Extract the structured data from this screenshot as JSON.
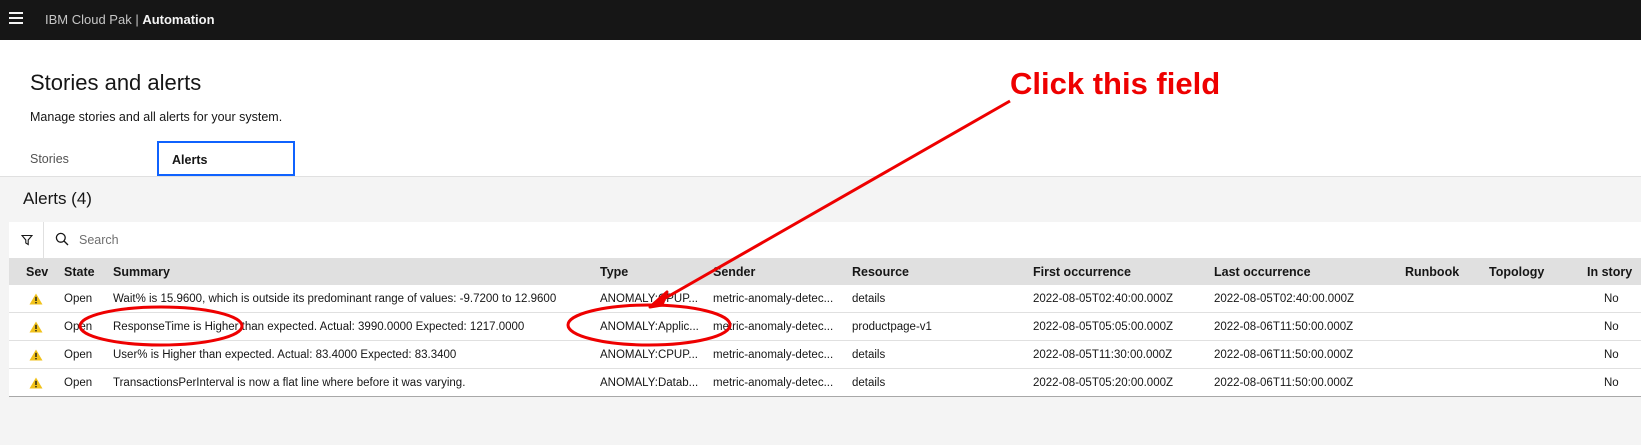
{
  "header": {
    "brand_prefix": "IBM Cloud Pak",
    "separator": " | ",
    "product": "Automation",
    "menu_icon": "hamburger-menu-icon"
  },
  "page": {
    "title": "Stories and alerts",
    "description": "Manage stories and all alerts for your system."
  },
  "tabs": [
    {
      "label": "Stories",
      "selected": false
    },
    {
      "label": "Alerts",
      "selected": true
    }
  ],
  "alerts": {
    "heading": "Alerts (4)",
    "filter_icon": "filter-icon",
    "search_icon": "search-icon",
    "search_placeholder": "Search",
    "columns": [
      "Sev",
      "State",
      "Summary",
      "Type",
      "Sender",
      "Resource",
      "First occurrence",
      "Last occurrence",
      "Runbook",
      "Topology",
      "In story"
    ],
    "rows": [
      {
        "sev": "warning",
        "state": "Open",
        "summary": "Wait% is 15.9600, which is outside its predominant range of values: -9.7200 to 12.9600",
        "type": "ANOMALY:CPUP...",
        "sender": "metric-anomaly-detec...",
        "resource": "details",
        "first": "2022-08-05T02:40:00.000Z",
        "last": "2022-08-05T02:40:00.000Z",
        "runbook": "",
        "topology": "",
        "in_story": "No"
      },
      {
        "sev": "warning",
        "state": "Open",
        "summary": "ResponseTime is Higher than expected. Actual: 3990.0000 Expected: 1217.0000",
        "type": "ANOMALY:Applic...",
        "sender": "metric-anomaly-detec...",
        "resource": "productpage-v1",
        "first": "2022-08-05T05:05:00.000Z",
        "last": "2022-08-06T11:50:00.000Z",
        "runbook": "",
        "topology": "",
        "in_story": "No"
      },
      {
        "sev": "warning",
        "state": "Open",
        "summary": "User% is Higher than expected. Actual: 83.4000 Expected: 83.3400",
        "type": "ANOMALY:CPUP...",
        "sender": "metric-anomaly-detec...",
        "resource": "details",
        "first": "2022-08-05T11:30:00.000Z",
        "last": "2022-08-06T11:50:00.000Z",
        "runbook": "",
        "topology": "",
        "in_story": "No"
      },
      {
        "sev": "warning",
        "state": "Open",
        "summary": "TransactionsPerInterval is now a flat line where before it was varying.",
        "type": "ANOMALY:Datab...",
        "sender": "metric-anomaly-detec...",
        "resource": "details",
        "first": "2022-08-05T05:20:00.000Z",
        "last": "2022-08-06T11:50:00.000Z",
        "runbook": "",
        "topology": "",
        "in_story": "No"
      }
    ]
  },
  "annotation": {
    "label": "Click this field",
    "color": "#ee0000"
  },
  "colors": {
    "topbar": "#161616",
    "selected_tab_border": "#0f62fe",
    "warning": "#f1c21b"
  }
}
